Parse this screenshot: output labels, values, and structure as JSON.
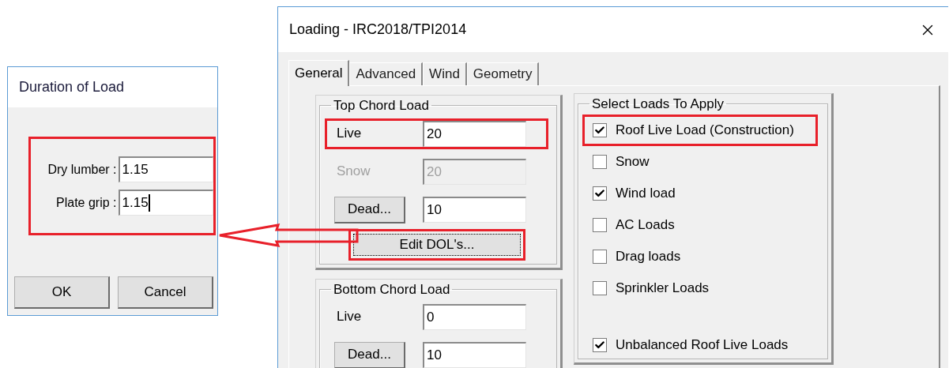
{
  "duration_dialog": {
    "title": "Duration of Load",
    "fields_highlighted": true,
    "fields": [
      {
        "label": "Dry lumber :",
        "value": "1.15",
        "focused": false
      },
      {
        "label": "Plate grip :",
        "value": "1.15",
        "focused": true
      }
    ],
    "buttons": [
      "OK",
      "Cancel"
    ]
  },
  "annotation_arrow": true,
  "loading_dialog": {
    "title": "Loading - IRC2018/TPI2014",
    "tabs": [
      {
        "label": "General",
        "selected": true
      },
      {
        "label": "Advanced",
        "selected": false
      },
      {
        "label": "Wind",
        "selected": false
      },
      {
        "label": "Geometry",
        "selected": false
      }
    ],
    "top_chord": {
      "title": "Top Chord Load",
      "rows": [
        {
          "kind": "label",
          "label": "Live",
          "value": "20",
          "disabled": false,
          "highlighted": true
        },
        {
          "kind": "label",
          "label": "Snow",
          "value": "20",
          "disabled": true,
          "highlighted": false
        },
        {
          "kind": "button",
          "label": "Dead...",
          "value": "10",
          "disabled": false,
          "highlighted": false
        }
      ],
      "edit_button": {
        "label": "Edit DOL's...",
        "highlighted": true
      }
    },
    "bottom_chord": {
      "title": "Bottom Chord Load",
      "rows": [
        {
          "kind": "label",
          "label": "Live",
          "value": "0",
          "disabled": false,
          "highlighted": false
        },
        {
          "kind": "button",
          "label": "Dead...",
          "value": "10",
          "disabled": false,
          "highlighted": false
        }
      ]
    },
    "loads": {
      "title": "Select Loads To Apply",
      "items": [
        {
          "label": "Roof Live Load (Construction)",
          "checked": true,
          "highlighted": true
        },
        {
          "label": "Snow",
          "checked": false,
          "highlighted": false
        },
        {
          "label": "Wind load",
          "checked": true,
          "highlighted": false
        },
        {
          "label": "AC Loads",
          "checked": false,
          "highlighted": false
        },
        {
          "label": "Drag loads",
          "checked": false,
          "highlighted": false
        },
        {
          "label": "Sprinkler Loads",
          "checked": false,
          "highlighted": false
        }
      ],
      "footer_item": {
        "label": "Unbalanced Roof Live Loads",
        "checked": true,
        "highlighted": false
      }
    }
  }
}
